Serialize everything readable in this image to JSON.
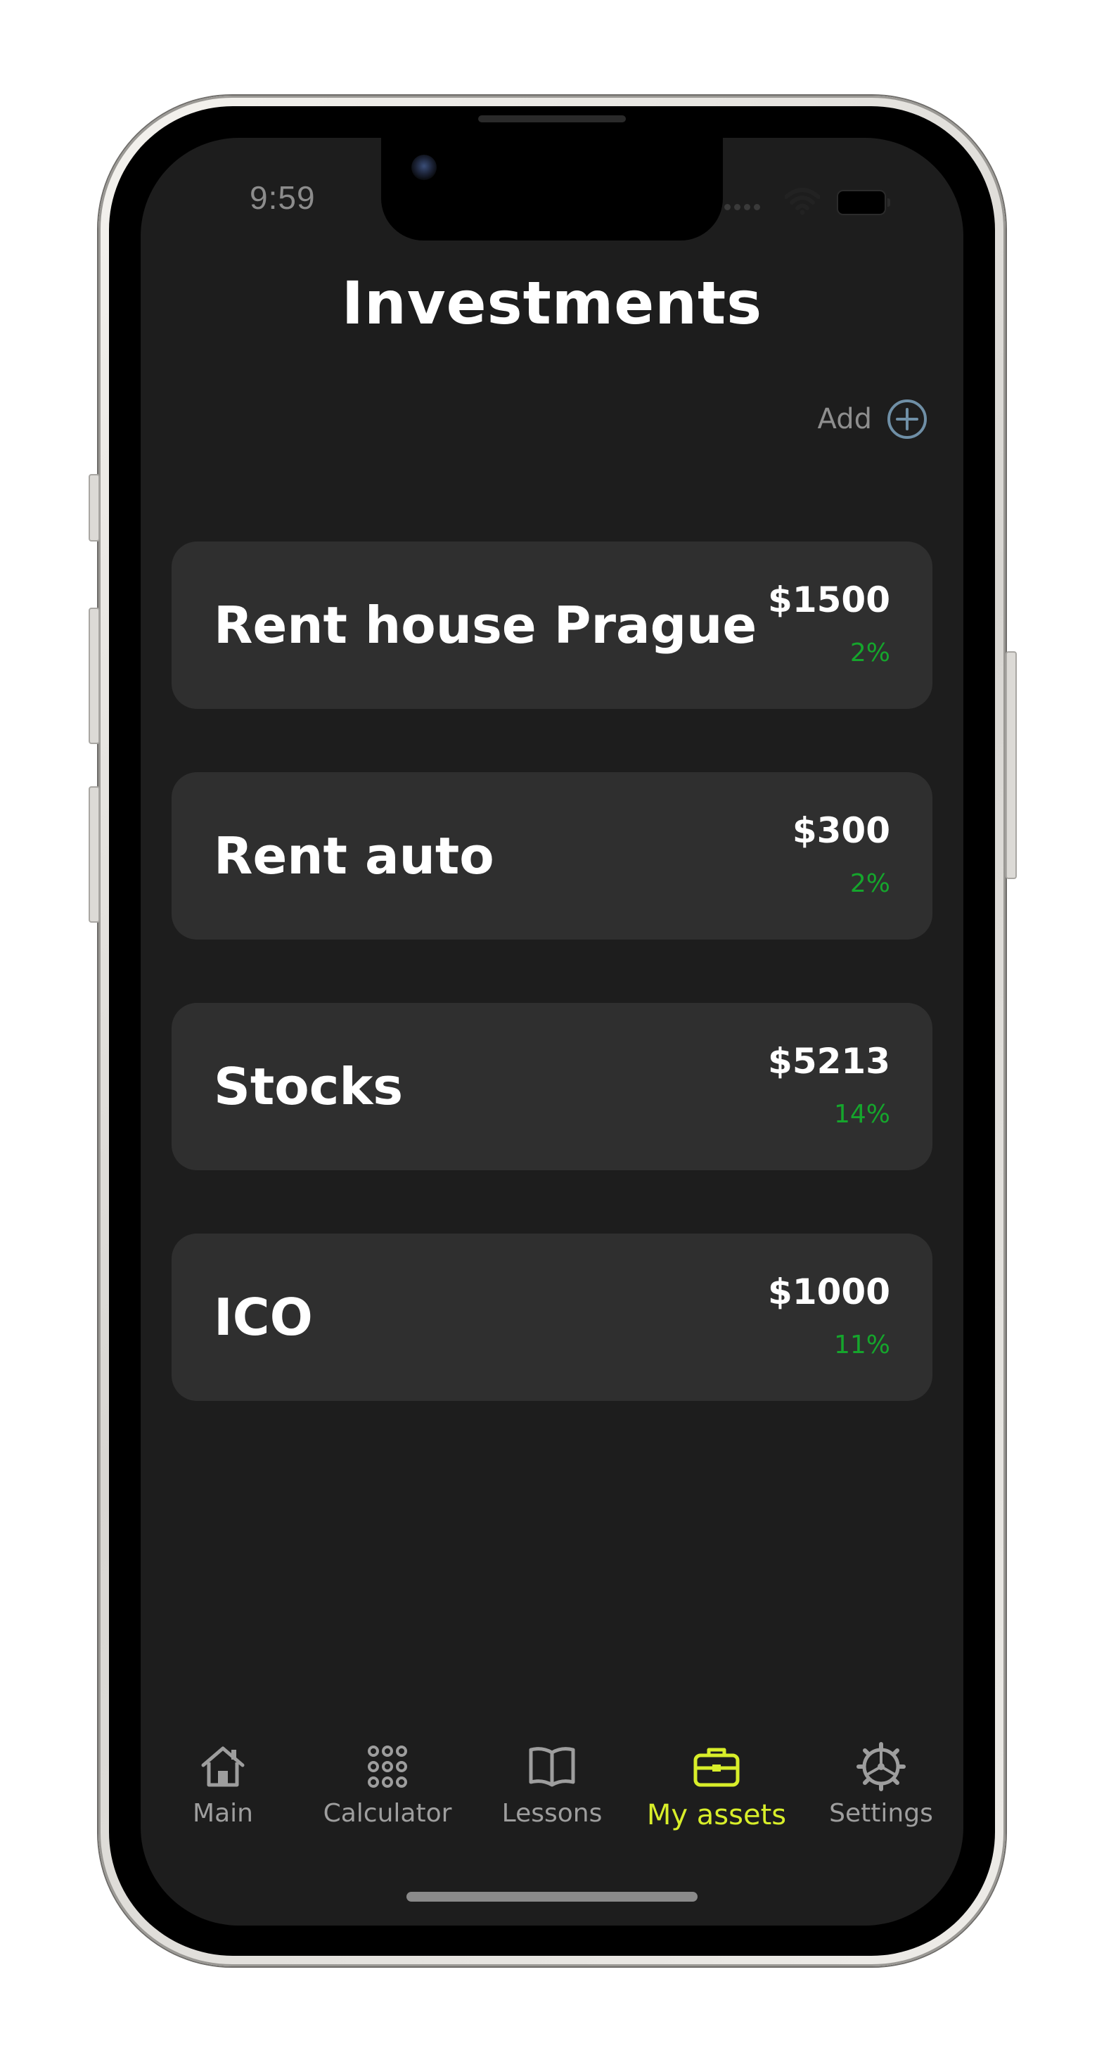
{
  "status_bar": {
    "time": "9:59"
  },
  "header": {
    "title": "Investments",
    "add_label": "Add"
  },
  "assets": [
    {
      "name": "Rent house Prague",
      "value": "$1500",
      "change": "2%"
    },
    {
      "name": "Rent auto",
      "value": "$300",
      "change": "2%"
    },
    {
      "name": "Stocks",
      "value": "$5213",
      "change": "14%"
    },
    {
      "name": "ICO",
      "value": "$1000",
      "change": "11%"
    }
  ],
  "tabs": [
    {
      "label": "Main",
      "icon": "home-icon"
    },
    {
      "label": "Calculator",
      "icon": "keypad-icon"
    },
    {
      "label": "Lessons",
      "icon": "book-icon"
    },
    {
      "label": "My assets",
      "icon": "briefcase-icon",
      "active": true
    },
    {
      "label": "Settings",
      "icon": "gear-icon"
    }
  ],
  "colors": {
    "background": "#1d1d1d",
    "card": "#2f2f2f",
    "positive_change": "#15a52c",
    "active_tab": "#d8ee2a",
    "inactive_tab": "#9e9e9e",
    "add_icon": "#6f8fa6"
  }
}
